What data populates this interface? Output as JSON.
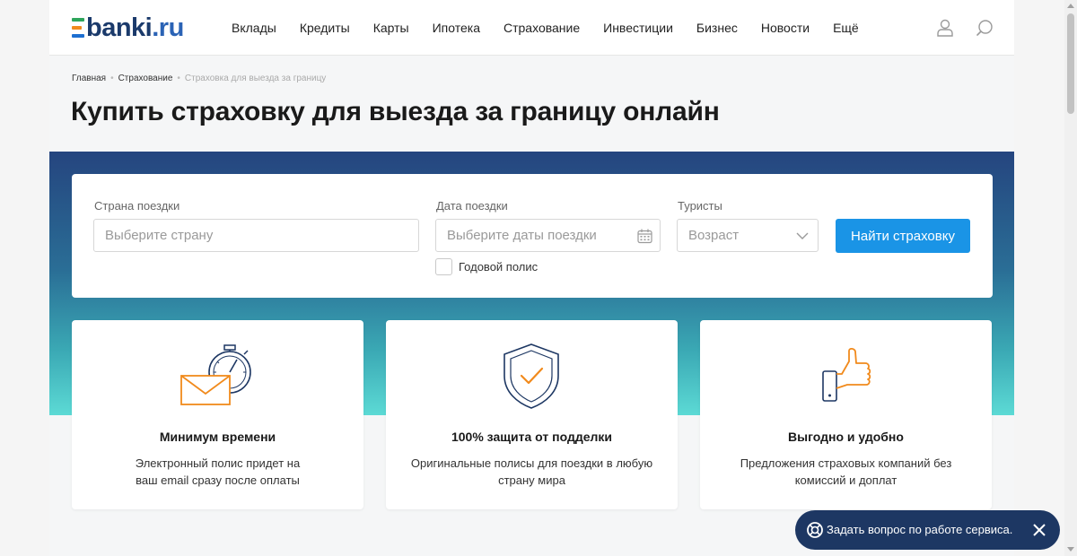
{
  "brand": {
    "name": "banki",
    "tld": ".ru",
    "logo_colors": [
      "#2ea55b",
      "#f18a1c",
      "#1d6fd1"
    ]
  },
  "nav": {
    "items": [
      "Вклады",
      "Кредиты",
      "Карты",
      "Ипотека",
      "Страхование",
      "Инвестиции",
      "Бизнес",
      "Новости",
      "Ещё"
    ],
    "user_icon": "user-icon",
    "search_icon": "search-icon"
  },
  "breadcrumbs": {
    "home": "Главная",
    "section": "Страхование",
    "current": "Страховка для выезда за границу"
  },
  "page_title": "Купить страховку для выезда за границу онлайн",
  "search_form": {
    "country_label": "Страна поездки",
    "country_placeholder": "Выберите страну",
    "date_label": "Дата поездки",
    "date_placeholder": "Выберите даты поездки",
    "tourists_label": "Туристы",
    "age_value": "Возраст",
    "annual_policy_label": "Годовой полис",
    "submit_label": "Найти страховку"
  },
  "features": [
    {
      "icon": "stopwatch-envelope-icon",
      "title": "Минимум времени",
      "description": "Электронный полис придет на ваш email сразу после оплаты"
    },
    {
      "icon": "shield-check-icon",
      "title": "100% защита от подделки",
      "description": "Оригинальные полисы для поездки в любую страну мира"
    },
    {
      "icon": "phone-thumbs-up-icon",
      "title": "Выгодно и удобно",
      "description": "Предложения страховых компаний без комиссий и доплат"
    }
  ],
  "support": {
    "label": "Задать вопрос по работе сервиса.",
    "icon": "lifebuoy-icon",
    "close_icon": "close-icon"
  },
  "colors": {
    "accent": "#1a94e6",
    "navy": "#1d3763",
    "orange": "#f18a1c",
    "hero_top": "#25457f",
    "hero_bottom": "#5cdad5"
  }
}
